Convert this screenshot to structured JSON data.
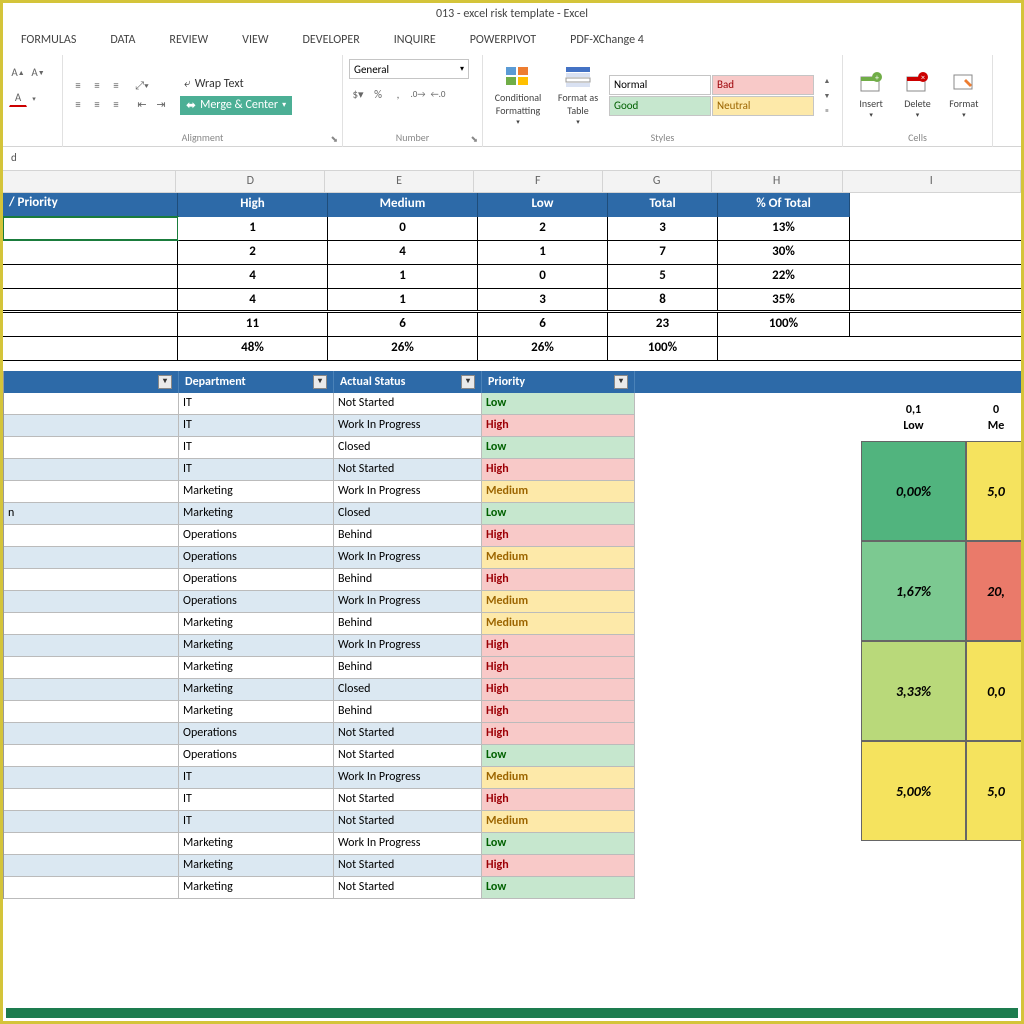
{
  "title": "013 - excel risk template - Excel",
  "menu": [
    "FORMULAS",
    "DATA",
    "REVIEW",
    "VIEW",
    "DEVELOPER",
    "INQUIRE",
    "POWERPIVOT",
    "PDF-XChange 4"
  ],
  "ribbon": {
    "wrap": "Wrap Text",
    "merge": "Merge & Center",
    "alignment": "Alignment",
    "number_format": "General",
    "number": "Number",
    "cond_fmt": "Conditional Formatting",
    "fmt_table": "Format as Table",
    "styles": "Styles",
    "normal": "Normal",
    "bad": "Bad",
    "good": "Good",
    "neutral": "Neutral",
    "insert": "Insert",
    "delete": "Delete",
    "format": "Format",
    "cells": "Cells"
  },
  "formula_value": "d",
  "columns": [
    "D",
    "E",
    "F",
    "G",
    "H",
    "I"
  ],
  "summary": {
    "corner": "/ Priority",
    "headers": [
      "High",
      "Medium",
      "Low",
      "Total",
      "% Of Total"
    ],
    "rows": [
      [
        "1",
        "0",
        "2",
        "3",
        "13%"
      ],
      [
        "2",
        "4",
        "1",
        "7",
        "30%"
      ],
      [
        "4",
        "1",
        "0",
        "5",
        "22%"
      ],
      [
        "4",
        "1",
        "3",
        "8",
        "35%"
      ],
      [
        "11",
        "6",
        "6",
        "23",
        "100%"
      ],
      [
        "48%",
        "26%",
        "26%",
        "100%",
        ""
      ]
    ]
  },
  "filter_headers": [
    "Department",
    "Actual Status",
    "Priority"
  ],
  "records": [
    {
      "dept": "IT",
      "status": "Not Started",
      "prio": "Low",
      "extra": ""
    },
    {
      "dept": "IT",
      "status": "Work In Progress",
      "prio": "High",
      "extra": ""
    },
    {
      "dept": "IT",
      "status": "Closed",
      "prio": "Low",
      "extra": ""
    },
    {
      "dept": "IT",
      "status": "Not Started",
      "prio": "High",
      "extra": ""
    },
    {
      "dept": "Marketing",
      "status": "Work In Progress",
      "prio": "Medium",
      "extra": ""
    },
    {
      "dept": "Marketing",
      "status": "Closed",
      "prio": "Low",
      "extra": "n"
    },
    {
      "dept": "Operations",
      "status": "Behind",
      "prio": "High",
      "extra": ""
    },
    {
      "dept": "Operations",
      "status": "Work In Progress",
      "prio": "Medium",
      "extra": ""
    },
    {
      "dept": "Operations",
      "status": "Behind",
      "prio": "High",
      "extra": ""
    },
    {
      "dept": "Operations",
      "status": "Work In Progress",
      "prio": "Medium",
      "extra": ""
    },
    {
      "dept": "Marketing",
      "status": "Behind",
      "prio": "Medium",
      "extra": ""
    },
    {
      "dept": "Marketing",
      "status": "Work In Progress",
      "prio": "High",
      "extra": ""
    },
    {
      "dept": "Marketing",
      "status": "Behind",
      "prio": "High",
      "extra": ""
    },
    {
      "dept": "Marketing",
      "status": "Closed",
      "prio": "High",
      "extra": ""
    },
    {
      "dept": "Marketing",
      "status": "Behind",
      "prio": "High",
      "extra": ""
    },
    {
      "dept": "Operations",
      "status": "Not Started",
      "prio": "High",
      "extra": ""
    },
    {
      "dept": "Operations",
      "status": "Not Started",
      "prio": "Low",
      "extra": ""
    },
    {
      "dept": "IT",
      "status": "Work In Progress",
      "prio": "Medium",
      "extra": ""
    },
    {
      "dept": "IT",
      "status": "Not Started",
      "prio": "High",
      "extra": ""
    },
    {
      "dept": "IT",
      "status": "Not Started",
      "prio": "Medium",
      "extra": ""
    },
    {
      "dept": "Marketing",
      "status": "Work In Progress",
      "prio": "Low",
      "extra": ""
    },
    {
      "dept": "Marketing",
      "status": "Not Started",
      "prio": "High",
      "extra": ""
    },
    {
      "dept": "Marketing",
      "status": "Not Started",
      "prio": "Low",
      "extra": ""
    }
  ],
  "matrix": {
    "top_a": "0,1",
    "top_b": "0",
    "lbl_a": "Low",
    "lbl_b": "Me",
    "cells": [
      [
        "0,00%",
        "5,0"
      ],
      [
        "1,67%",
        "20,"
      ],
      [
        "3,33%",
        "0,0"
      ],
      [
        "5,00%",
        "5,0"
      ]
    ],
    "colors": [
      [
        "mg1",
        "my"
      ],
      [
        "mg2",
        "mr"
      ],
      [
        "mg3",
        "my"
      ],
      [
        "my",
        "my"
      ]
    ]
  }
}
